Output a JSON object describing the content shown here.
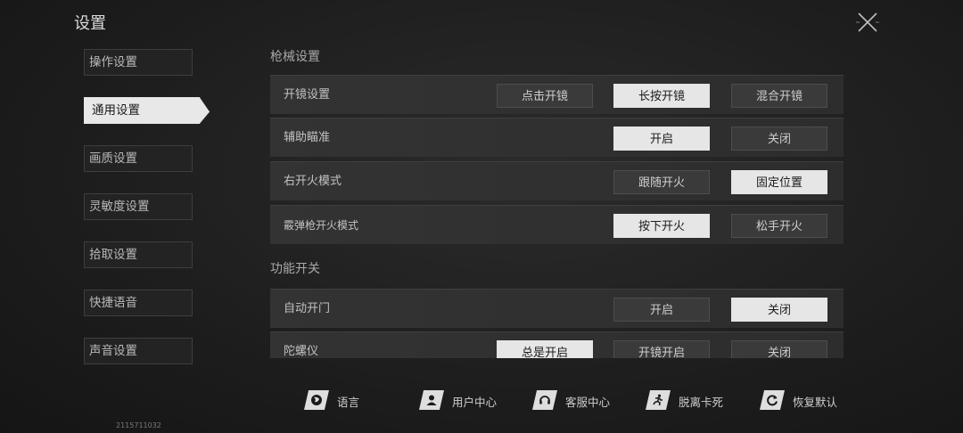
{
  "page": {
    "title": "设置",
    "build_id": "2115711032"
  },
  "nav": [
    {
      "label": "操作设置",
      "active": false
    },
    {
      "label": "通用设置",
      "active": true
    },
    {
      "label": "画质设置",
      "active": false
    },
    {
      "label": "灵敏度设置",
      "active": false
    },
    {
      "label": "拾取设置",
      "active": false
    },
    {
      "label": "快捷语音",
      "active": false
    },
    {
      "label": "声音设置",
      "active": false
    }
  ],
  "sections": {
    "weapon": {
      "title": "枪械设置",
      "rows": [
        {
          "label": "开镜设置",
          "options": [
            "点击开镜",
            "长按开镜",
            "混合开镜"
          ],
          "selected": 1
        },
        {
          "label": "辅助瞄准",
          "options": [
            "开启",
            "关闭"
          ],
          "selected": 0
        },
        {
          "label": "右开火模式",
          "options": [
            "跟随开火",
            "固定位置"
          ],
          "selected": 1
        },
        {
          "label": "霰弹枪开火模式",
          "options": [
            "按下开火",
            "松手开火"
          ],
          "selected": 0
        }
      ]
    },
    "function": {
      "title": "功能开关",
      "rows": [
        {
          "label": "自动开门",
          "options": [
            "开启",
            "关闭"
          ],
          "selected": 1
        },
        {
          "label": "陀螺仪",
          "options": [
            "总是开启",
            "开镜开启",
            "关闭"
          ],
          "selected": 0
        }
      ]
    }
  },
  "footer": [
    {
      "label": "语言",
      "icon": "globe-icon"
    },
    {
      "label": "用户中心",
      "icon": "user-icon"
    },
    {
      "label": "客服中心",
      "icon": "headset-icon"
    },
    {
      "label": "脱离卡死",
      "icon": "running-icon"
    },
    {
      "label": "恢复默认",
      "icon": "reset-icon"
    }
  ],
  "colors": {
    "selected": "#e6e6e6",
    "unselected": "#3a3a3a",
    "background": "#1e1e1e"
  }
}
